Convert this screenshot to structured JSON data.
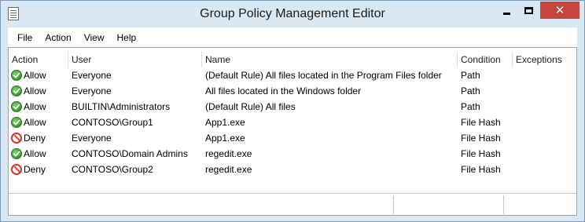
{
  "window": {
    "title": "Group Policy Management Editor"
  },
  "controls": {
    "minimize_icon": "minimize-icon",
    "maximize_icon": "maximize-icon",
    "close_glyph": "✕"
  },
  "menu": [
    "File",
    "Action",
    "View",
    "Help"
  ],
  "columns": [
    "Action",
    "User",
    "Name",
    "Condition",
    "Exceptions"
  ],
  "rules": [
    {
      "action": "Allow",
      "icon": "allow-icon",
      "user": "Everyone",
      "name": "(Default Rule) All files located in the Program Files folder",
      "condition": "Path",
      "exceptions": ""
    },
    {
      "action": "Allow",
      "icon": "allow-icon",
      "user": "Everyone",
      "name": "All files located in the Windows folder",
      "condition": "Path",
      "exceptions": ""
    },
    {
      "action": "Allow",
      "icon": "allow-icon",
      "user": "BUILTIN\\Administrators",
      "name": "(Default Rule) All files",
      "condition": "Path",
      "exceptions": ""
    },
    {
      "action": "Allow",
      "icon": "allow-icon",
      "user": "CONTOSO\\Group1",
      "name": "App1.exe",
      "condition": "File Hash",
      "exceptions": ""
    },
    {
      "action": "Deny",
      "icon": "deny-icon",
      "user": "Everyone",
      "name": "App1.exe",
      "condition": "File Hash",
      "exceptions": ""
    },
    {
      "action": "Allow",
      "icon": "allow-icon",
      "user": "CONTOSO\\Domain Admins",
      "name": "regedit.exe",
      "condition": "File Hash",
      "exceptions": ""
    },
    {
      "action": "Deny",
      "icon": "deny-icon",
      "user": "CONTOSO\\Group2",
      "name": "regedit.exe",
      "condition": "File Hash",
      "exceptions": ""
    }
  ],
  "colors": {
    "allow": "#3c9a2a",
    "deny": "#d8352a",
    "close_button": "#c7463b",
    "frame": "#d8e8f5"
  }
}
